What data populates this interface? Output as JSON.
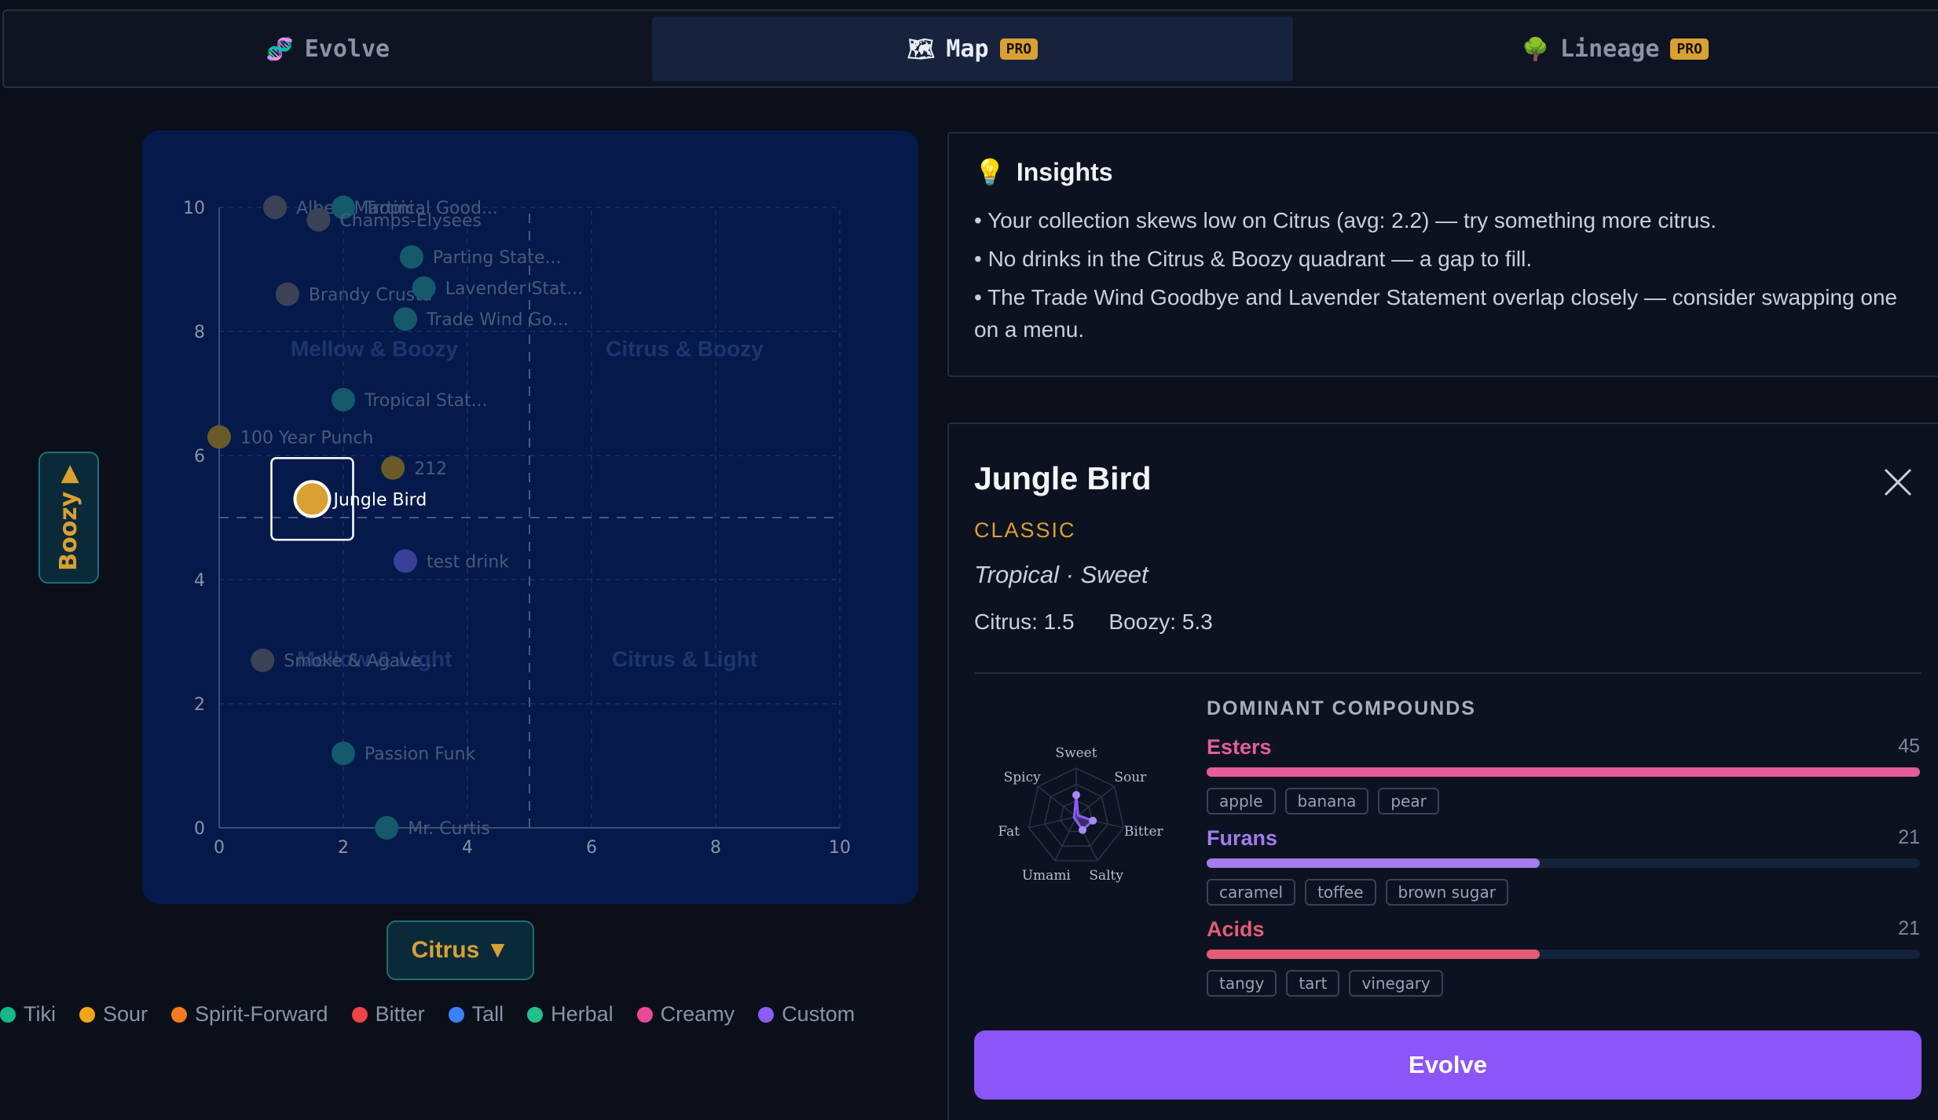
{
  "tabs": [
    {
      "label": "Evolve",
      "icon": "dna-icon",
      "pro": ""
    },
    {
      "label": "Map",
      "icon": "map-icon",
      "pro": "PRO"
    },
    {
      "label": "Lineage",
      "icon": "tree-icon",
      "pro": "PRO"
    }
  ],
  "axis_buttons": {
    "y": "Boozy ▶",
    "x": "Citrus ▼"
  },
  "map": {
    "quadrants": [
      "Mellow & Boozy",
      "Citrus & Boozy",
      "Mellow & Light",
      "Citrus & Light"
    ],
    "x_ticks": [
      "0",
      "2",
      "4",
      "6",
      "8",
      "10"
    ],
    "y_ticks": [
      "0",
      "2",
      "4",
      "6",
      "8",
      "10"
    ],
    "points": [
      {
        "label": "Albert Martini",
        "x": 0.9,
        "y": 10.0,
        "category": "Custom"
      },
      {
        "label": "Tropical Good...",
        "x": 2.0,
        "y": 10.0,
        "category": "Tiki"
      },
      {
        "label": "Champs-Elysees",
        "x": 1.6,
        "y": 9.8,
        "category": "Custom"
      },
      {
        "label": "Parting State...",
        "x": 3.1,
        "y": 9.2,
        "category": "Tiki"
      },
      {
        "label": "Brandy Crusta",
        "x": 1.1,
        "y": 8.6,
        "category": "Custom"
      },
      {
        "label": "Lavender Stat...",
        "x": 3.3,
        "y": 8.7,
        "category": "Tiki"
      },
      {
        "label": "Trade Wind Go...",
        "x": 3.0,
        "y": 8.2,
        "category": "Tiki"
      },
      {
        "label": "Tropical Stat...",
        "x": 2.0,
        "y": 6.9,
        "category": "Tiki"
      },
      {
        "label": "100 Year Punch",
        "x": 0.0,
        "y": 6.3,
        "category": "Sour"
      },
      {
        "label": "212",
        "x": 2.8,
        "y": 5.8,
        "category": "Sour"
      },
      {
        "label": "Jungle Bird",
        "x": 1.5,
        "y": 5.3,
        "category": "Sour",
        "selected": true
      },
      {
        "label": "test drink",
        "x": 3.0,
        "y": 4.3,
        "category": "Custom"
      },
      {
        "label": "Smoke & Agave...",
        "x": 0.7,
        "y": 2.7,
        "category": "Custom"
      },
      {
        "label": "Passion Funk",
        "x": 2.0,
        "y": 1.2,
        "category": "Tiki"
      },
      {
        "label": "Mr. Curtis",
        "x": 2.7,
        "y": 0.0,
        "category": "Tiki"
      }
    ]
  },
  "legend": [
    {
      "label": "Tiki",
      "color": "#16b98a"
    },
    {
      "label": "Sour",
      "color": "#f2a516"
    },
    {
      "label": "Spirit-Forward",
      "color": "#f47a1f"
    },
    {
      "label": "Bitter",
      "color": "#ef4444"
    },
    {
      "label": "Tall",
      "color": "#3b82f6"
    },
    {
      "label": "Herbal",
      "color": "#22c08a"
    },
    {
      "label": "Creamy",
      "color": "#ec4899"
    },
    {
      "label": "Custom",
      "color": "#8b5cf6"
    }
  ],
  "insights": {
    "title": "Insights",
    "lines": [
      "• Your collection skews low on Citrus (avg: 2.2) — try something more citrus.",
      "• No drinks in the Citrus & Boozy quadrant — a gap to fill.",
      "• The Trade Wind Goodbye and Lavender Statement overlap closely — consider swapping one on a menu."
    ]
  },
  "detail": {
    "title": "Jungle Bird",
    "category": "CLASSIC",
    "flavors": "Tropical · Sweet",
    "citrus": "Citrus: 1.5",
    "boozy": "Boozy: 5.3",
    "radar": {
      "axes": [
        "Sweet",
        "Sour",
        "Bitter",
        "Salty",
        "Umami",
        "Fat",
        "Spicy"
      ],
      "values": [
        0.45,
        0.05,
        0.35,
        0.3,
        0.05,
        0.05,
        0.05
      ]
    },
    "compounds_title": "DOMINANT COMPOUNDS",
    "compounds": [
      {
        "name": "Esters",
        "value": "45",
        "fraction": 1.0,
        "color": "#e35d9c",
        "tags": [
          "apple",
          "banana",
          "pear"
        ]
      },
      {
        "name": "Furans",
        "value": "21",
        "fraction": 0.467,
        "color": "#a37cf0",
        "tags": [
          "caramel",
          "toffee",
          "brown sugar"
        ]
      },
      {
        "name": "Acids",
        "value": "21",
        "fraction": 0.467,
        "color": "#e35d77",
        "tags": [
          "tangy",
          "tart",
          "vinegary"
        ]
      }
    ],
    "evolve_label": "Evolve"
  }
}
